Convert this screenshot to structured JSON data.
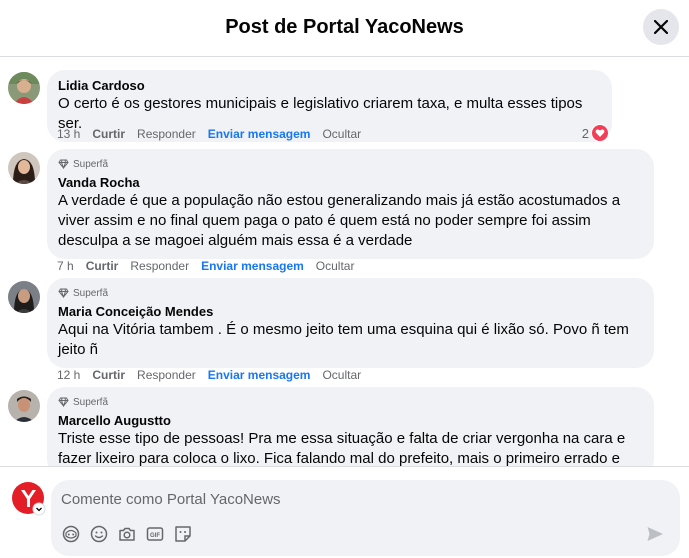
{
  "header": {
    "title": "Post de Portal YacoNews",
    "close_icon": "close-icon"
  },
  "comments": [
    {
      "author": "Lidia Cardoso",
      "badge": "",
      "text_lines": [
        "O certo é os gestores municipais e legislativo criarem taxa, e multa esses tipos ser."
      ],
      "time": "13 h",
      "actions": [
        "Curtir",
        "Responder",
        "Enviar mensagem",
        "Ocultar"
      ],
      "reaction_count": "2",
      "reaction_icon": "heart-icon"
    },
    {
      "author": "Vanda Rocha",
      "badge": "Superfã",
      "text_lines": [
        "A verdade é que a população não estou generalizando mais já estão acostumados a",
        "viver assim e no final quem paga o pato é quem está no poder sempre foi assim",
        "desculpa a se magoei alguém mais essa é a verdade"
      ],
      "time": "7 h",
      "actions": [
        "Curtir",
        "Responder",
        "Enviar mensagem",
        "Ocultar"
      ]
    },
    {
      "author": "Maria Conceição Mendes",
      "badge": "Superfã",
      "text_lines": [
        "Aqui na Vitória tambem . É o mesmo jeito tem uma esquina qui é lixão só. Povo ñ tem",
        "jeito ñ"
      ],
      "time": "12 h",
      "actions": [
        "Curtir",
        "Responder",
        "Enviar mensagem",
        "Ocultar"
      ]
    },
    {
      "author": "Marcello Augustto",
      "badge": "Superfã",
      "text_lines": [
        "Triste esse tipo de pessoas! Pra me essa situação e falta de criar vergonha na cara e",
        "fazer lixeiro para coloca o lixo. Fica falando mal do prefeito, mais o primeiro errado e"
      ]
    }
  ],
  "composer": {
    "placeholder": "Comente como Portal YacoNews",
    "tools": [
      "avatar-sticker-icon",
      "emoji-icon",
      "camera-icon",
      "gif-icon",
      "sticker-icon"
    ],
    "send_icon": "send-icon"
  },
  "colors": {
    "link": "#1877f2",
    "bubble": "#f0f2f5",
    "heart": "#f33e58",
    "brand": "#e41e26"
  }
}
